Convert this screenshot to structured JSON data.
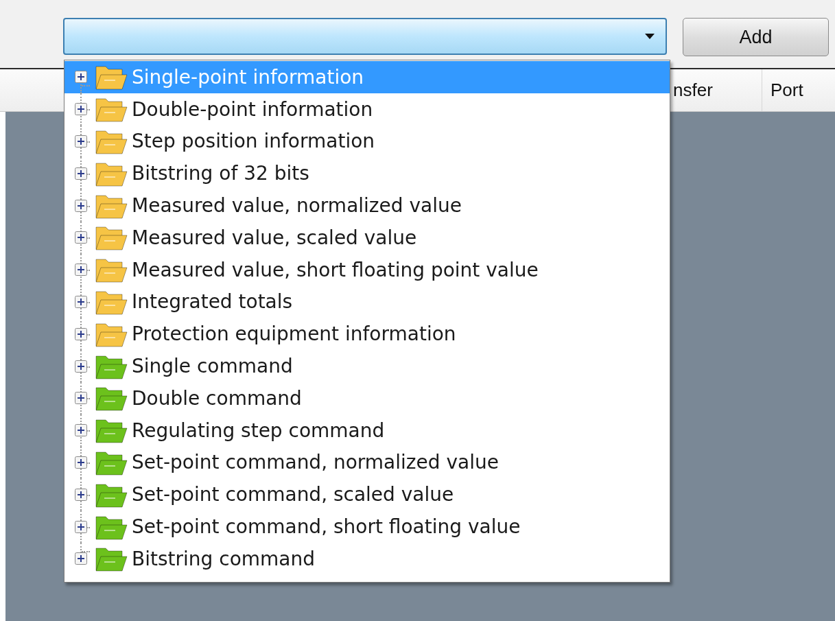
{
  "toolbar": {
    "add_button": "Add"
  },
  "table": {
    "columns": [
      {
        "label": "nsfer"
      },
      {
        "label": "Port"
      }
    ]
  },
  "dropdown": {
    "items": [
      {
        "label": "Single-point information",
        "color": "#f6c445",
        "selected": true,
        "expanded": false
      },
      {
        "label": "Double-point information",
        "color": "#f6c445",
        "selected": false,
        "expanded": false
      },
      {
        "label": "Step position information",
        "color": "#f6c445",
        "selected": false,
        "expanded": false
      },
      {
        "label": "Bitstring of 32 bits",
        "color": "#f6c445",
        "selected": false,
        "expanded": false
      },
      {
        "label": "Measured value, normalized value",
        "color": "#f6c445",
        "selected": false,
        "expanded": false
      },
      {
        "label": "Measured value, scaled value",
        "color": "#f6c445",
        "selected": false,
        "expanded": false
      },
      {
        "label": "Measured value, short floating point value",
        "color": "#f6c445",
        "selected": false,
        "expanded": false
      },
      {
        "label": "Integrated totals",
        "color": "#f6c445",
        "selected": false,
        "expanded": false
      },
      {
        "label": "Protection equipment information",
        "color": "#f6c445",
        "selected": false,
        "expanded": false
      },
      {
        "label": "Single command",
        "color": "#6cc11c",
        "selected": false,
        "expanded": false
      },
      {
        "label": "Double command",
        "color": "#6cc11c",
        "selected": false,
        "expanded": false
      },
      {
        "label": "Regulating step command",
        "color": "#6cc11c",
        "selected": false,
        "expanded": false
      },
      {
        "label": "Set-point command, normalized value",
        "color": "#6cc11c",
        "selected": false,
        "expanded": false
      },
      {
        "label": "Set-point command, scaled value",
        "color": "#6cc11c",
        "selected": false,
        "expanded": false
      },
      {
        "label": "Set-point command, short floating value",
        "color": "#6cc11c",
        "selected": false,
        "expanded": false
      },
      {
        "label": "Bitstring command",
        "color": "#6cc11c",
        "selected": false,
        "expanded": false
      }
    ]
  }
}
